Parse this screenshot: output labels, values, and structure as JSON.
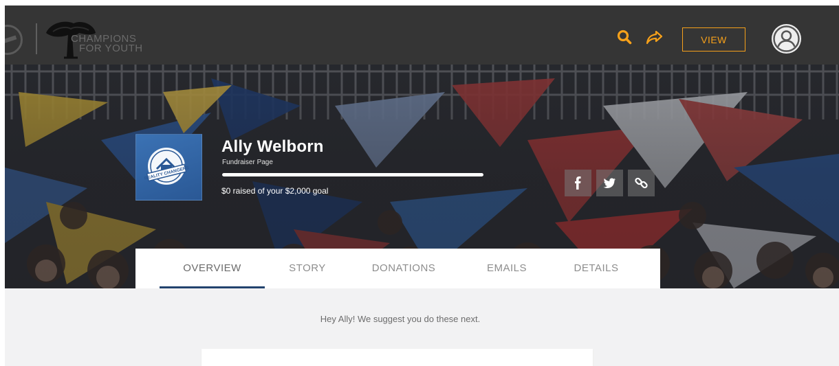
{
  "header": {
    "logo_text_line1": "CHAMPIONS",
    "logo_text_line2": "FOR YOUTH",
    "view_label": "VIEW",
    "accent_color": "#f7a11a"
  },
  "profile": {
    "name": "Ally Welborn",
    "subtitle": "Fundraiser Page",
    "raised_text": "$0 raised of your $2,000 goal",
    "progress_fraction": 1.0,
    "badge_logo_text": "REALITY CHANGERS"
  },
  "social": {
    "icons": [
      "facebook-icon",
      "twitter-icon",
      "link-icon"
    ]
  },
  "tabs": [
    {
      "label": "OVERVIEW",
      "active": true
    },
    {
      "label": "STORY",
      "active": false
    },
    {
      "label": "DONATIONS",
      "active": false
    },
    {
      "label": "EMAILS",
      "active": false
    },
    {
      "label": "DETAILS",
      "active": false
    }
  ],
  "body": {
    "suggestion_text": "Hey Ally! We suggest you do these next."
  },
  "colors": {
    "topbar": "#353535",
    "tab_underline": "#22436e",
    "page_bg": "#f2f2f3"
  }
}
